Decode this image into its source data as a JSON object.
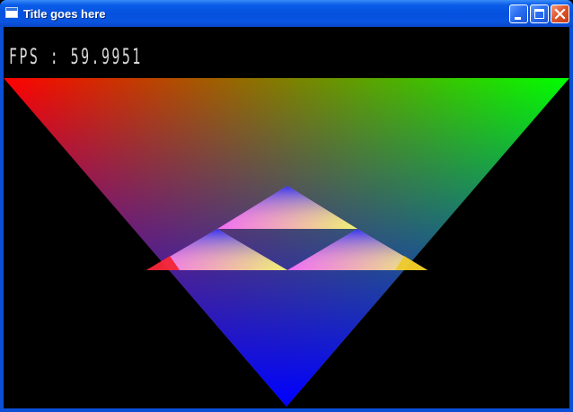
{
  "window": {
    "title": "Title goes here",
    "border_color": "#0a4fd6",
    "client_background": "#000000"
  },
  "title_bar_buttons": {
    "minimize_icon": "minimize-icon",
    "maximize_icon": "maximize-icon",
    "close_icon": "close-icon"
  },
  "hud": {
    "fps_text": "FPS : 59.9951",
    "fps_color": "#d8d8d8"
  },
  "scene": {
    "large_triangle_colors": {
      "top_left": "#ff0000",
      "top_right": "#00ff00",
      "bottom": "#0000ff"
    },
    "small_triangle_colors": {
      "top": "#0000ff",
      "left": "#ff00ff",
      "right": "#ffff00"
    }
  }
}
